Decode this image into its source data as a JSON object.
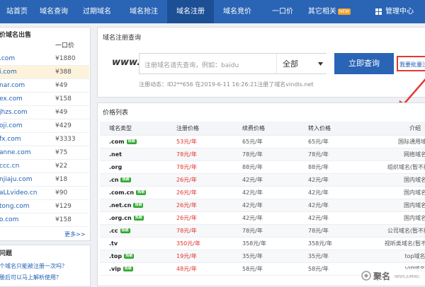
{
  "nav": {
    "items": [
      {
        "label": "站首页"
      },
      {
        "label": "域名查询"
      },
      {
        "label": "过期域名"
      },
      {
        "label": "域名抢注"
      },
      {
        "label": "域名注册"
      },
      {
        "label": "域名竞价"
      },
      {
        "label": "一口价"
      },
      {
        "label": "其它相关",
        "badge": "NEW"
      },
      {
        "label": "管理中心"
      }
    ],
    "active_index": 4
  },
  "sidebar": {
    "title": "价域名出售",
    "col_header": "一口价",
    "rows": [
      {
        "domain": ".com",
        "price": "¥1880"
      },
      {
        "domain": "i.com",
        "price": "¥388"
      },
      {
        "domain": "nar.com",
        "price": "¥49"
      },
      {
        "domain": "ex.com",
        "price": "¥158"
      },
      {
        "domain": "jhzs.com",
        "price": "¥49"
      },
      {
        "domain": "oji.com",
        "price": "¥429"
      },
      {
        "domain": "fx.com",
        "price": "¥3333"
      },
      {
        "domain": "anne.com",
        "price": "¥75"
      },
      {
        "domain": "ccc.cn",
        "price": "¥22"
      },
      {
        "domain": "njiaju.com",
        "price": "¥18"
      },
      {
        "domain": "aLLvideo.cn",
        "price": "¥90"
      },
      {
        "domain": "tong.com",
        "price": "¥129"
      },
      {
        "domain": "o.com",
        "price": "¥158"
      }
    ],
    "more": "更多>>",
    "faq_title": "问题",
    "faq_items": [
      "个域名只能被注册一次吗？",
      "册后可以马上解析使用？"
    ]
  },
  "search": {
    "title": "域名注册查询",
    "www_label": "www.",
    "placeholder": "注册域名请先查询，例如：baidu",
    "select_value": "全部",
    "button": "立即查询",
    "batch_link": "我要批量注",
    "news": "注册动态：ID2**656 在2019-6-11 16:26:21注册了域名vindis.net"
  },
  "prices": {
    "title": "价格列表",
    "headers": [
      "域名类型",
      "注册价格",
      "续费价格",
      "转入价格",
      "介绍"
    ],
    "hot_label": "热销",
    "rows": [
      {
        "ext": ".com",
        "hot": true,
        "reg": "53元/年",
        "renew": "65元/年",
        "transfer": "65元/年",
        "desc": "国际通用域名"
      },
      {
        "ext": ".net",
        "hot": false,
        "reg": "78元/年",
        "renew": "78元/年",
        "transfer": "78元/年",
        "desc": "网络域名"
      },
      {
        "ext": ".org",
        "hot": false,
        "reg": "78元/年",
        "renew": "88元/年",
        "transfer": "88元/年",
        "desc": "组织域名(暂不能备案)"
      },
      {
        "ext": ".cn",
        "hot": true,
        "reg": "26元/年",
        "renew": "42元/年",
        "transfer": "42元/年",
        "desc": "国内域名"
      },
      {
        "ext": ".com.cn",
        "hot": true,
        "reg": "26元/年",
        "renew": "42元/年",
        "transfer": "42元/年",
        "desc": "国内域名"
      },
      {
        "ext": ".net.cn",
        "hot": true,
        "reg": "26元/年",
        "renew": "42元/年",
        "transfer": "42元/年",
        "desc": "国内域名"
      },
      {
        "ext": ".org.cn",
        "hot": true,
        "reg": "26元/年",
        "renew": "42元/年",
        "transfer": "42元/年",
        "desc": "国内域名"
      },
      {
        "ext": ".cc",
        "hot": true,
        "reg": "78元/年",
        "renew": "78元/年",
        "transfer": "78元/年",
        "desc": "公司域名(暂不能备案)"
      },
      {
        "ext": ".tv",
        "hot": false,
        "reg": "350元/年",
        "renew": "358元/年",
        "transfer": "358元/年",
        "desc": "视听类域名(暂不能备案)"
      },
      {
        "ext": ".top",
        "hot": true,
        "reg": "19元/年",
        "renew": "35元/年",
        "transfer": "35元/年",
        "desc": "top域名"
      },
      {
        "ext": ".vip",
        "hot": true,
        "reg": "48元/年",
        "renew": "58元/年",
        "transfer": "58元/年",
        "desc": "VIP域名"
      }
    ]
  },
  "watermark": {
    "main": "聚名",
    "sub": "NEWS.JUMING"
  },
  "colors": {
    "nav_bg": "#2a64b5",
    "button_bg": "#2a64b5",
    "price_red": "#e0332b",
    "link_blue": "#1f5fb3",
    "highlight_row": "#fdf3dc",
    "arrow_red": "#e53935"
  }
}
